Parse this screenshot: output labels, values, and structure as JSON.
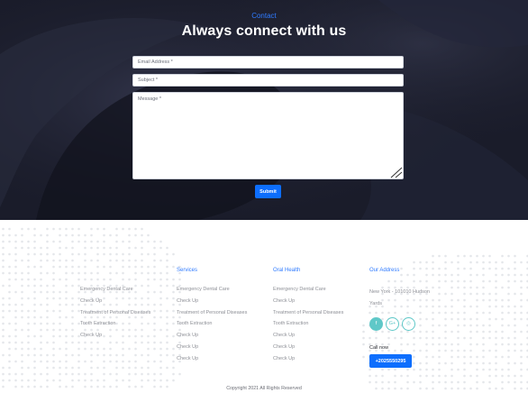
{
  "contact": {
    "eyebrow": "Contact",
    "title": "Always connect with us",
    "email_placeholder": "Email Address *",
    "subject_placeholder": "Subject *",
    "message_placeholder": "Message *",
    "submit_label": "Submit"
  },
  "footer": {
    "columns": [
      {
        "heading": "",
        "items": [
          "Emergency Dental Care",
          "Check Up",
          "Treatment of Personal Diseases",
          "Tooth Extraction",
          "Check Up"
        ]
      },
      {
        "heading": "Services",
        "items": [
          "Emergency Dental Care",
          "Check Up",
          "Treatment of Personal Diseases",
          "Tooth Extraction",
          "Check Up",
          "Check Up",
          "Check Up"
        ]
      },
      {
        "heading": "Oral Health",
        "items": [
          "Emergency Dental Care",
          "Check Up",
          "Treatment of Personal Diseases",
          "Tooth Extraction",
          "Check Up",
          "Check Up",
          "Check Up"
        ]
      }
    ],
    "address": {
      "heading": "Our Address",
      "line1": "New York - 101010 Hudson",
      "line2": "Yards"
    },
    "socials": [
      {
        "icon": "facebook-icon",
        "glyph": "f"
      },
      {
        "icon": "google-plus-icon",
        "glyph": "G+"
      },
      {
        "icon": "instagram-icon",
        "glyph": "◎"
      }
    ],
    "call_label": "Call now",
    "phone": "+2025550295",
    "copyright": "Copyright 2021 All Rights Reserved"
  },
  "colors": {
    "accent": "#0d6efd",
    "heading_blue": "#2f7bff",
    "hero_bg": "#1b1d2c",
    "social_teal": "#5fc8c8",
    "link_gray": "#8d8f96"
  }
}
